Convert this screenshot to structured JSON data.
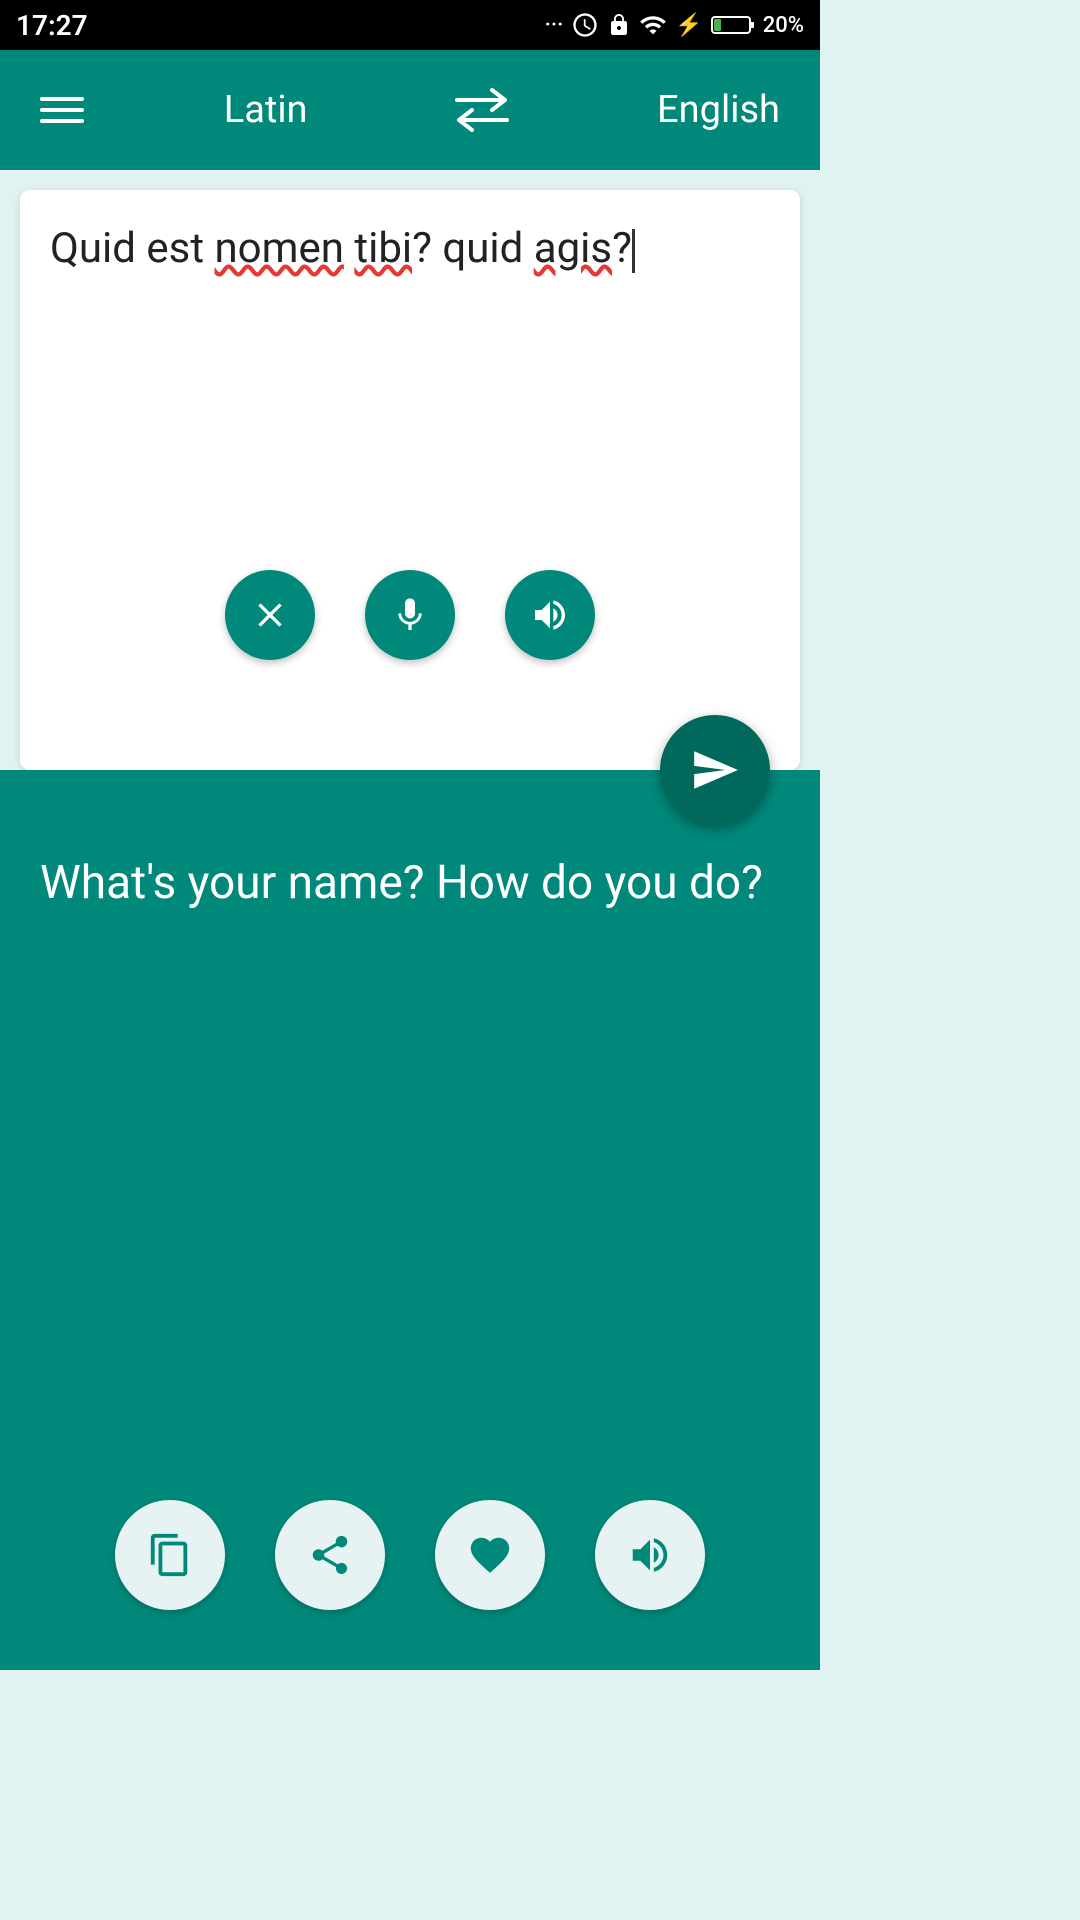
{
  "statusBar": {
    "time": "17:27",
    "batteryPercent": "20%"
  },
  "topNav": {
    "menuLabel": "menu",
    "sourceLanguage": "Latin",
    "swapLabel": "swap languages",
    "targetLanguage": "English"
  },
  "inputSection": {
    "inputText": "Quid est nomen tibi? quid agis?",
    "spellErrorWords": [
      "nomen",
      "tibi",
      "agis"
    ],
    "clearLabel": "clear",
    "micLabel": "microphone",
    "speakLabel": "speak input",
    "translateLabel": "translate"
  },
  "outputSection": {
    "outputText": "What's your name? How do you do?",
    "copyLabel": "copy",
    "shareLabel": "share",
    "favoriteLabel": "favorite",
    "speakOutputLabel": "speak output"
  }
}
